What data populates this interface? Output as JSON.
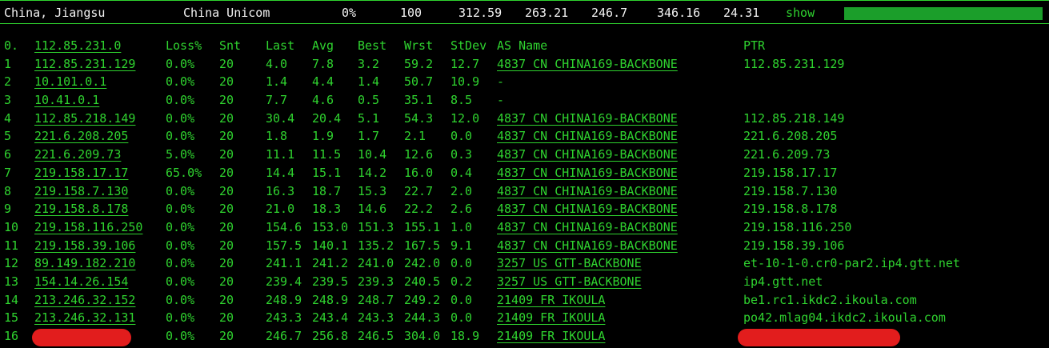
{
  "summary": {
    "location": "China, Jiangsu",
    "isp": "China Unicom",
    "loss": "0%",
    "sent": "100",
    "last": "312.59",
    "avg": "263.21",
    "best": "246.7",
    "worst": "346.16",
    "stdev": "24.31",
    "show_link": "show",
    "bar_color": "#1b9e2a"
  },
  "header": {
    "idx": "0.",
    "ip": "112.85.231.0",
    "loss": "Loss%",
    "snt": "Snt",
    "last": "Last",
    "avg": "Avg",
    "best": "Best",
    "wrst": "Wrst",
    "stdev": "StDev",
    "as": "AS Name",
    "ptr": "PTR"
  },
  "rows": [
    {
      "idx": "1",
      "ip": "112.85.231.129",
      "loss": "0.0%",
      "snt": "20",
      "last": "4.0",
      "avg": "7.8",
      "best": "3.2",
      "wrst": "59.2",
      "std": "12.7",
      "as": "4837  CN CHINA169-BACKBONE",
      "ptr": "112.85.231.129"
    },
    {
      "idx": "2",
      "ip": "10.101.0.1",
      "loss": "0.0%",
      "snt": "20",
      "last": "1.4",
      "avg": "4.4",
      "best": "1.4",
      "wrst": "50.7",
      "std": "10.9",
      "as": "-",
      "ptr": ""
    },
    {
      "idx": "3",
      "ip": "10.41.0.1",
      "loss": "0.0%",
      "snt": "20",
      "last": "7.7",
      "avg": "4.6",
      "best": "0.5",
      "wrst": "35.1",
      "std": "8.5",
      "as": "-",
      "ptr": ""
    },
    {
      "idx": "4",
      "ip": "112.85.218.149",
      "loss": "0.0%",
      "snt": "20",
      "last": "30.4",
      "avg": "20.4",
      "best": "5.1",
      "wrst": "54.3",
      "std": "12.0",
      "as": "4837  CN CHINA169-BACKBONE",
      "ptr": "112.85.218.149"
    },
    {
      "idx": "5",
      "ip": "221.6.208.205",
      "loss": "0.0%",
      "snt": "20",
      "last": "1.8",
      "avg": "1.9",
      "best": "1.7",
      "wrst": "2.1",
      "std": "0.0",
      "as": "4837  CN CHINA169-BACKBONE",
      "ptr": "221.6.208.205"
    },
    {
      "idx": "6",
      "ip": "221.6.209.73",
      "loss": "5.0%",
      "snt": "20",
      "last": "11.1",
      "avg": "11.5",
      "best": "10.4",
      "wrst": "12.6",
      "std": "0.3",
      "as": "4837  CN CHINA169-BACKBONE",
      "ptr": "221.6.209.73"
    },
    {
      "idx": "7",
      "ip": "219.158.17.17",
      "loss": "65.0%",
      "snt": "20",
      "last": "14.4",
      "avg": "15.1",
      "best": "14.2",
      "wrst": "16.0",
      "std": "0.4",
      "as": "4837  CN CHINA169-BACKBONE",
      "ptr": "219.158.17.17"
    },
    {
      "idx": "8",
      "ip": "219.158.7.130",
      "loss": "0.0%",
      "snt": "20",
      "last": "16.3",
      "avg": "18.7",
      "best": "15.3",
      "wrst": "22.7",
      "std": "2.0",
      "as": "4837  CN CHINA169-BACKBONE",
      "ptr": "219.158.7.130"
    },
    {
      "idx": "9",
      "ip": "219.158.8.178",
      "loss": "0.0%",
      "snt": "20",
      "last": "21.0",
      "avg": "18.3",
      "best": "14.6",
      "wrst": "22.2",
      "std": "2.6",
      "as": "4837  CN CHINA169-BACKBONE",
      "ptr": "219.158.8.178"
    },
    {
      "idx": "10",
      "ip": "219.158.116.250",
      "loss": "0.0%",
      "snt": "20",
      "last": "154.6",
      "avg": "153.0",
      "best": "151.3",
      "wrst": "155.1",
      "std": "1.0",
      "as": "4837  CN CHINA169-BACKBONE",
      "ptr": "219.158.116.250"
    },
    {
      "idx": "11",
      "ip": "219.158.39.106",
      "loss": "0.0%",
      "snt": "20",
      "last": "157.5",
      "avg": "140.1",
      "best": "135.2",
      "wrst": "167.5",
      "std": "9.1",
      "as": "4837  CN CHINA169-BACKBONE",
      "ptr": "219.158.39.106"
    },
    {
      "idx": "12",
      "ip": "89.149.182.210",
      "loss": "0.0%",
      "snt": "20",
      "last": "241.1",
      "avg": "241.2",
      "best": "241.0",
      "wrst": "242.0",
      "std": "0.0",
      "as": "3257  US GTT-BACKBONE",
      "ptr": "et-10-1-0.cr0-par2.ip4.gtt.net"
    },
    {
      "idx": "13",
      "ip": "154.14.26.154",
      "loss": "0.0%",
      "snt": "20",
      "last": "239.4",
      "avg": "239.5",
      "best": "239.3",
      "wrst": "240.5",
      "std": "0.2",
      "as": "3257  US GTT-BACKBONE",
      "ptr": "ip4.gtt.net"
    },
    {
      "idx": "14",
      "ip": "213.246.32.152",
      "loss": "0.0%",
      "snt": "20",
      "last": "248.9",
      "avg": "248.9",
      "best": "248.7",
      "wrst": "249.2",
      "std": "0.0",
      "as": "21409 FR IKOULA",
      "ptr": "be1.rc1.ikdc2.ikoula.com"
    },
    {
      "idx": "15",
      "ip": "213.246.32.131",
      "loss": "0.0%",
      "snt": "20",
      "last": "243.3",
      "avg": "243.4",
      "best": "243.3",
      "wrst": "244.3",
      "std": "0.0",
      "as": "21409 FR IKOULA",
      "ptr": "po42.mlag04.ikdc2.ikoula.com"
    },
    {
      "idx": "16",
      "ip": "",
      "loss": "0.0%",
      "snt": "20",
      "last": "246.7",
      "avg": "256.8",
      "best": "246.5",
      "wrst": "304.0",
      "std": "18.9",
      "as": "21409 FR IKOULA",
      "ptr": ""
    }
  ]
}
